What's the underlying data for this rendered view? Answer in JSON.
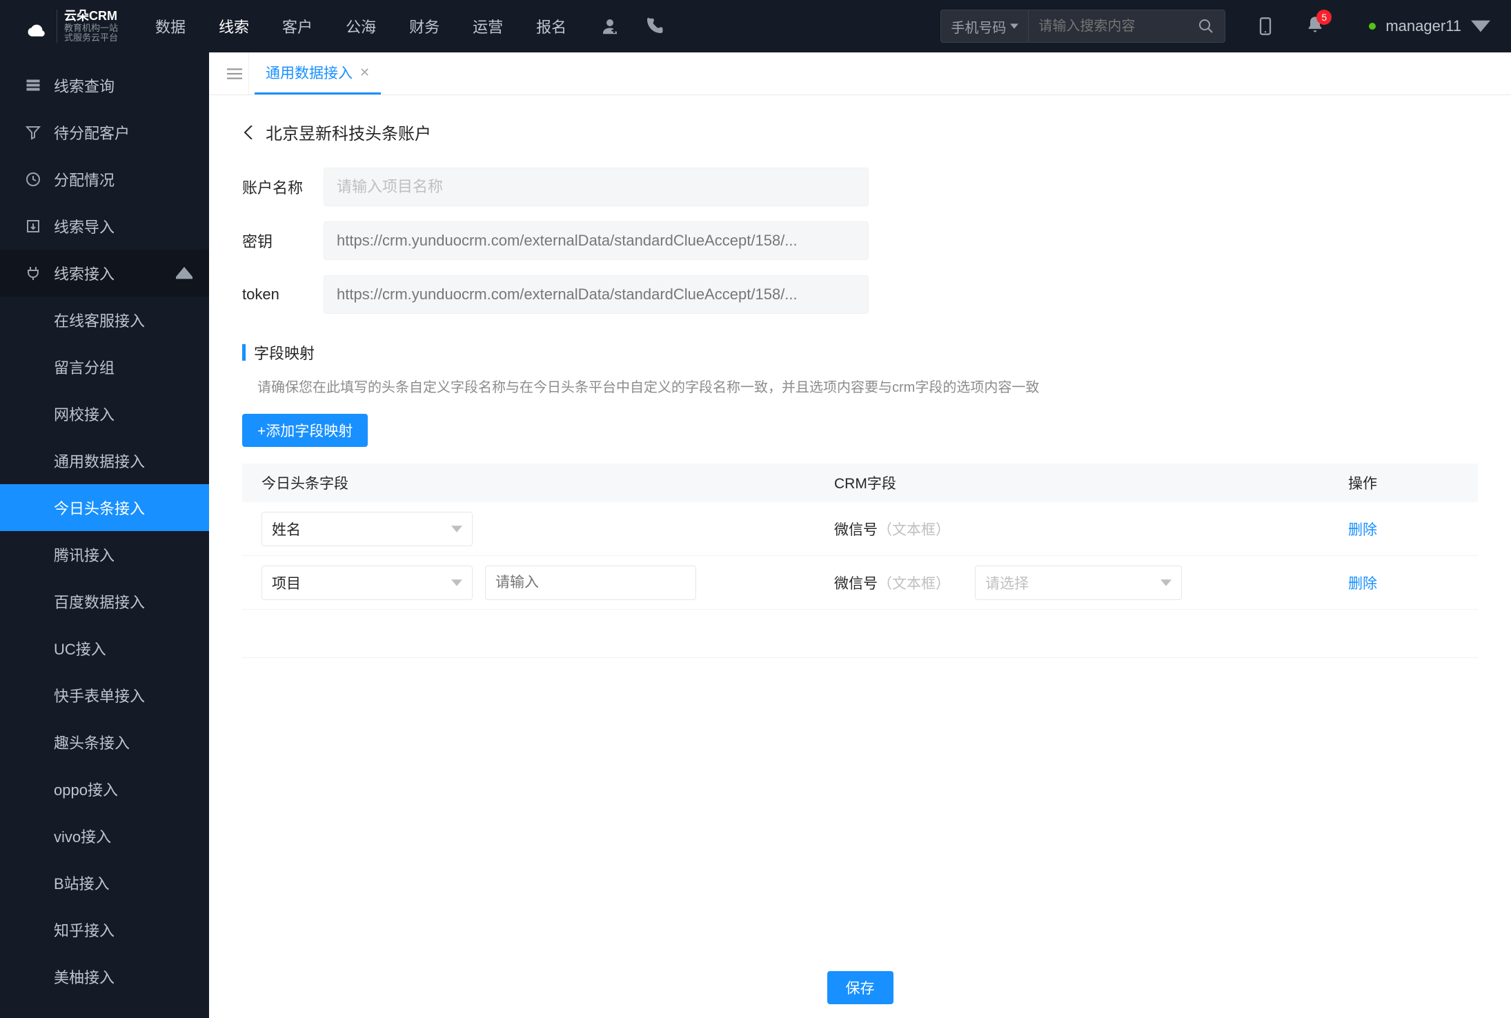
{
  "header": {
    "logo_brand": "云朵CRM",
    "logo_sub1": "教育机构一站",
    "logo_sub2": "式服务云平台",
    "nav": [
      "数据",
      "线索",
      "客户",
      "公海",
      "财务",
      "运营",
      "报名"
    ],
    "nav_active": "线索",
    "search_type": "手机号码",
    "search_placeholder": "请输入搜索内容",
    "badge": "5",
    "username": "manager11"
  },
  "sidebar": {
    "items": [
      {
        "label": "线索查询",
        "icon": "list"
      },
      {
        "label": "待分配客户",
        "icon": "filter"
      },
      {
        "label": "分配情况",
        "icon": "clock"
      },
      {
        "label": "线索导入",
        "icon": "export"
      },
      {
        "label": "线索接入",
        "icon": "plug",
        "expanded": true,
        "children": [
          "在线客服接入",
          "留言分组",
          "网校接入",
          "通用数据接入",
          "今日头条接入",
          "腾讯接入",
          "百度数据接入",
          "UC接入",
          "快手表单接入",
          "趣头条接入",
          "oppo接入",
          "vivo接入",
          "B站接入",
          "知乎接入",
          "美柚接入"
        ],
        "active_child": "今日头条接入"
      }
    ]
  },
  "tabs": {
    "active": "通用数据接入"
  },
  "page": {
    "title": "北京昱新科技头条账户",
    "form": {
      "name_label": "账户名称",
      "name_placeholder": "请输入项目名称",
      "secret_label": "密钥",
      "secret_value": "https://crm.yunduocrm.com/externalData/standardClueAccept/158/...",
      "token_label": "token",
      "token_value": "https://crm.yunduocrm.com/externalData/standardClueAccept/158/..."
    },
    "section_title": "字段映射",
    "hint": "请确保您在此填写的头条自定义字段名称与在今日头条平台中自定义的字段名称一致，并且选项内容要与crm字段的选项内容一致",
    "add_btn": "+添加字段映射",
    "table": {
      "headers": [
        "今日头条字段",
        "CRM字段",
        "操作"
      ],
      "rows": [
        {
          "tt_field": "姓名",
          "crm_label": "微信号",
          "crm_hint": "（文本框）",
          "delete": "删除",
          "type": "simple"
        },
        {
          "tt_field": "项目",
          "tt_input_placeholder": "请输入",
          "crm_label": "微信号",
          "crm_hint": "（文本框）",
          "crm_sel_placeholder": "请选择",
          "delete": "删除",
          "type": "with_input"
        }
      ]
    },
    "save": "保存"
  }
}
